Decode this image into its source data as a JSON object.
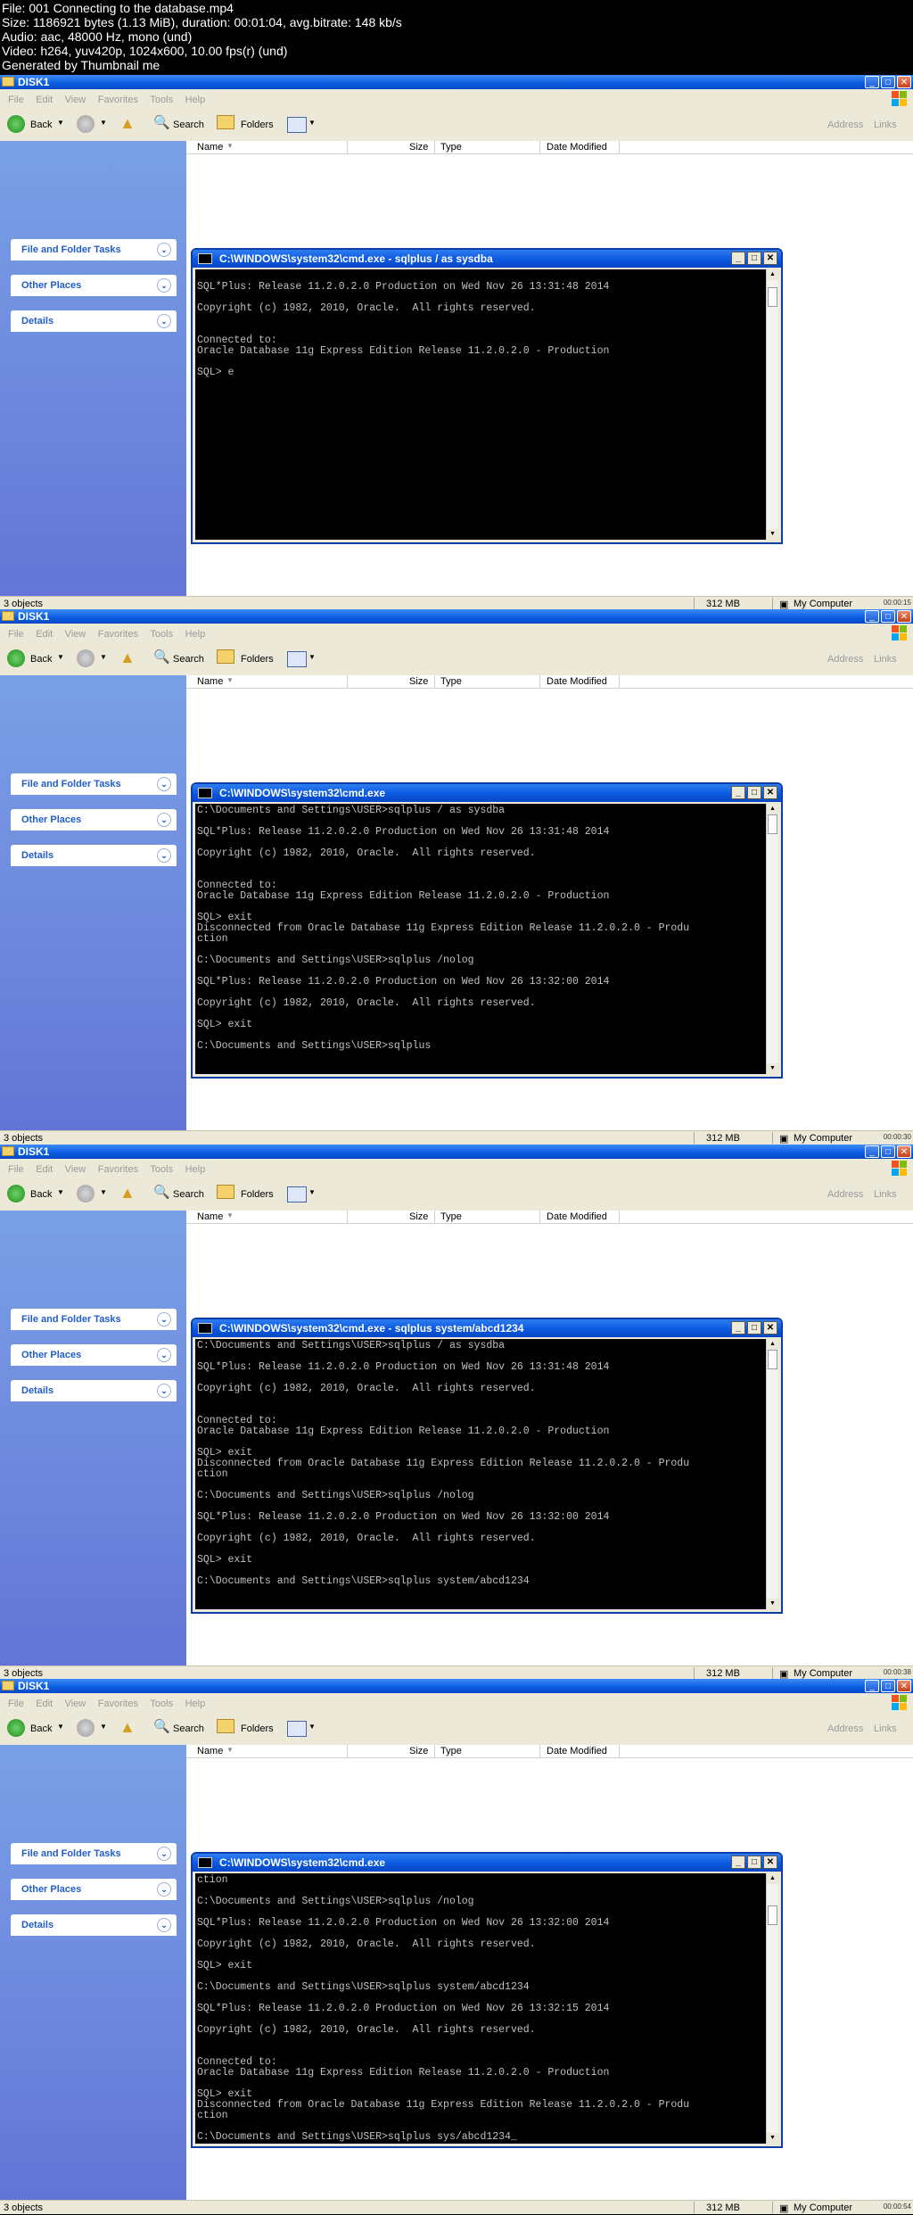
{
  "header": {
    "lines": [
      "File: 001 Connecting to the database.mp4",
      "Size: 1186921 bytes (1.13 MiB), duration: 00:01:04, avg.bitrate: 148 kb/s",
      "Audio: aac, 48000 Hz, mono (und)",
      "Video: h264, yuv420p, 1024x600, 10.00 fps(r) (und)",
      "Generated by Thumbnail me"
    ]
  },
  "explorer": {
    "title": "DISK1",
    "menu": [
      "File",
      "Edit",
      "View",
      "Favorites",
      "Tools",
      "Help"
    ],
    "toolbar": {
      "back": "Back",
      "search": "Search",
      "folders": "Folders",
      "address": "Address",
      "links": "Links"
    },
    "tasks": [
      "File and Folder Tasks",
      "Other Places",
      "Details"
    ],
    "columns": [
      "Name",
      "Size",
      "Type",
      "Date Modified"
    ],
    "status": {
      "objects": "3 objects",
      "size": "312 MB",
      "location": "My Computer"
    },
    "colors": {
      "sidebar": "#6e8ee0",
      "titlebar": "#0a5ce0"
    }
  },
  "frames": [
    {
      "timestamp": "00:00:15",
      "cmd_title": "C:\\WINDOWS\\system32\\cmd.exe - sqlplus  / as sysdba",
      "lines": [
        "",
        "SQL*Plus: Release 11.2.0.2.0 Production on Wed Nov 26 13:31:48 2014",
        "",
        "Copyright (c) 1982, 2010, Oracle.  All rights reserved.",
        "",
        "",
        "Connected to:",
        "Oracle Database 11g Express Edition Release 11.2.0.2.0 - Production",
        "",
        "SQL> e"
      ]
    },
    {
      "timestamp": "00:00:30",
      "cmd_title": "C:\\WINDOWS\\system32\\cmd.exe",
      "lines": [
        "C:\\Documents and Settings\\USER>sqlplus / as sysdba",
        "",
        "SQL*Plus: Release 11.2.0.2.0 Production on Wed Nov 26 13:31:48 2014",
        "",
        "Copyright (c) 1982, 2010, Oracle.  All rights reserved.",
        "",
        "",
        "Connected to:",
        "Oracle Database 11g Express Edition Release 11.2.0.2.0 - Production",
        "",
        "SQL> exit",
        "Disconnected from Oracle Database 11g Express Edition Release 11.2.0.2.0 - Produ",
        "ction",
        "",
        "C:\\Documents and Settings\\USER>sqlplus /nolog",
        "",
        "SQL*Plus: Release 11.2.0.2.0 Production on Wed Nov 26 13:32:00 2014",
        "",
        "Copyright (c) 1982, 2010, Oracle.  All rights reserved.",
        "",
        "SQL> exit",
        "",
        "C:\\Documents and Settings\\USER>sqlplus"
      ]
    },
    {
      "timestamp": "00:00:38",
      "cmd_title": "C:\\WINDOWS\\system32\\cmd.exe - sqlplus  system/abcd1234",
      "lines": [
        "C:\\Documents and Settings\\USER>sqlplus / as sysdba",
        "",
        "SQL*Plus: Release 11.2.0.2.0 Production on Wed Nov 26 13:31:48 2014",
        "",
        "Copyright (c) 1982, 2010, Oracle.  All rights reserved.",
        "",
        "",
        "Connected to:",
        "Oracle Database 11g Express Edition Release 11.2.0.2.0 - Production",
        "",
        "SQL> exit",
        "Disconnected from Oracle Database 11g Express Edition Release 11.2.0.2.0 - Produ",
        "ction",
        "",
        "C:\\Documents and Settings\\USER>sqlplus /nolog",
        "",
        "SQL*Plus: Release 11.2.0.2.0 Production on Wed Nov 26 13:32:00 2014",
        "",
        "Copyright (c) 1982, 2010, Oracle.  All rights reserved.",
        "",
        "SQL> exit",
        "",
        "C:\\Documents and Settings\\USER>sqlplus system/abcd1234"
      ]
    },
    {
      "timestamp": "00:00:54",
      "cmd_title": "C:\\WINDOWS\\system32\\cmd.exe",
      "lines": [
        "ction",
        "",
        "C:\\Documents and Settings\\USER>sqlplus /nolog",
        "",
        "SQL*Plus: Release 11.2.0.2.0 Production on Wed Nov 26 13:32:00 2014",
        "",
        "Copyright (c) 1982, 2010, Oracle.  All rights reserved.",
        "",
        "SQL> exit",
        "",
        "C:\\Documents and Settings\\USER>sqlplus system/abcd1234",
        "",
        "SQL*Plus: Release 11.2.0.2.0 Production on Wed Nov 26 13:32:15 2014",
        "",
        "Copyright (c) 1982, 2010, Oracle.  All rights reserved.",
        "",
        "",
        "Connected to:",
        "Oracle Database 11g Express Edition Release 11.2.0.2.0 - Production",
        "",
        "SQL> exit",
        "Disconnected from Oracle Database 11g Express Edition Release 11.2.0.2.0 - Produ",
        "ction",
        "",
        "C:\\Documents and Settings\\USER>sqlplus sys/abcd1234_"
      ]
    }
  ]
}
